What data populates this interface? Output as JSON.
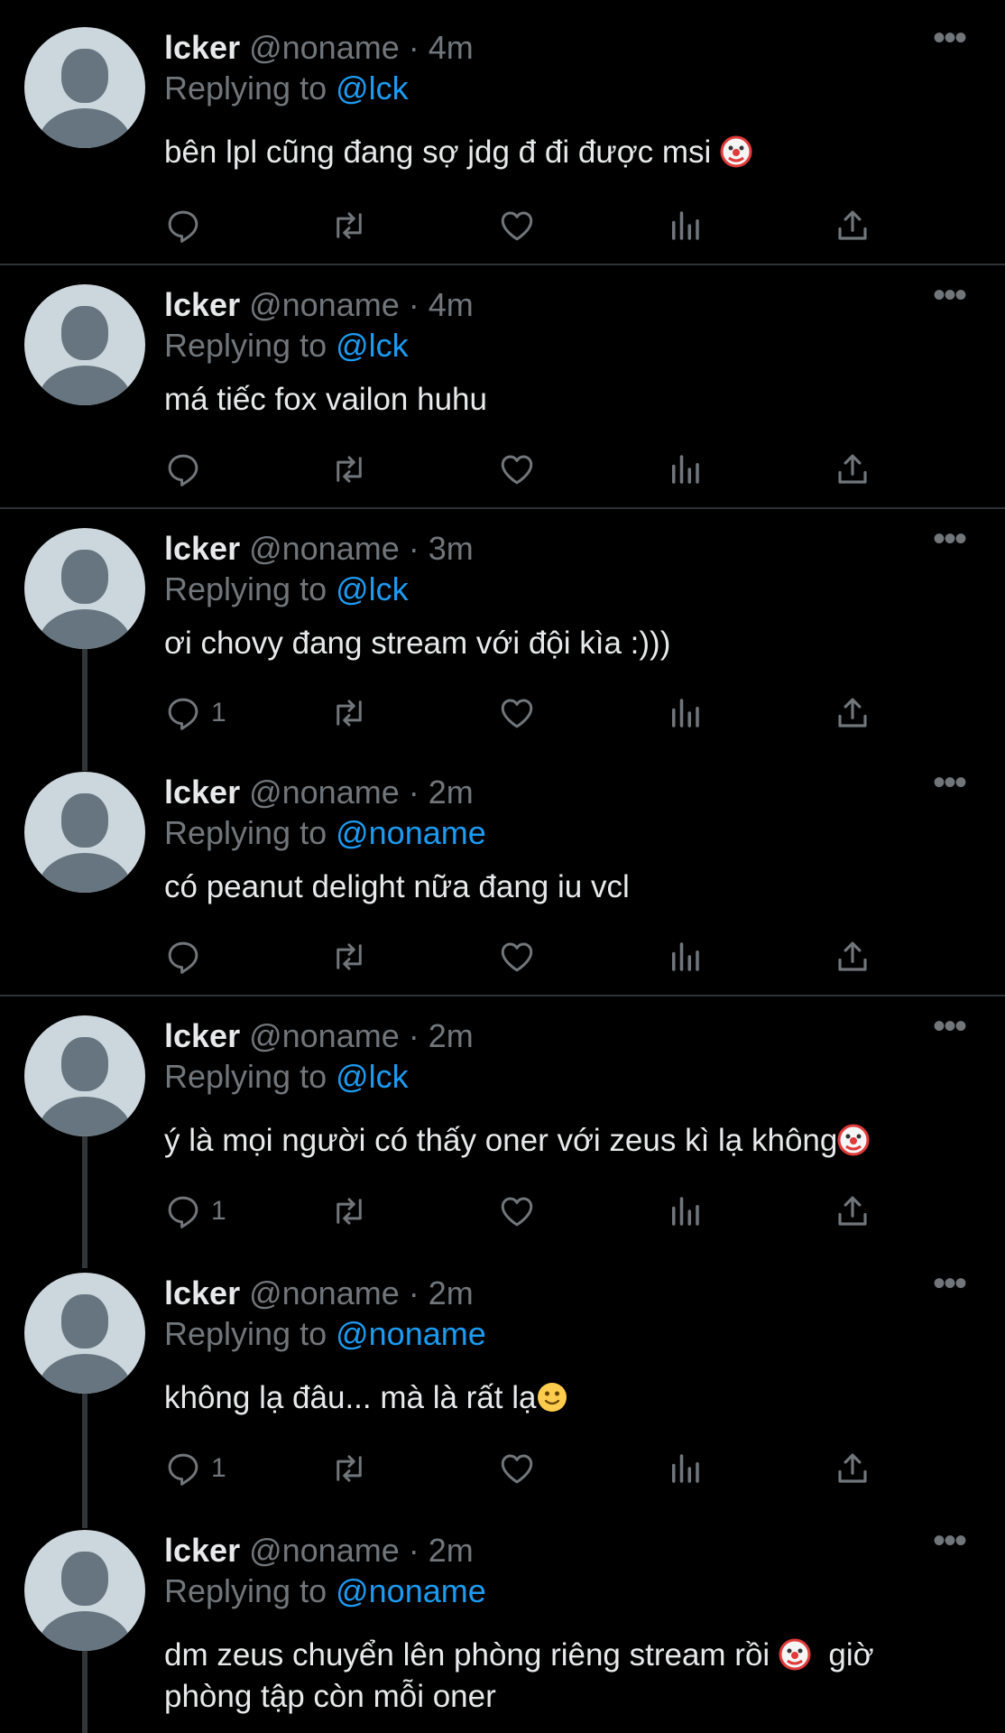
{
  "tweets": [
    {
      "name": "lcker",
      "handle": "@noname",
      "dot": "·",
      "time": "4m",
      "replying_prefix": "Replying to ",
      "reply_to": "@lck",
      "text": "bên lpl cũng đang sợ jdg đ đi được msi",
      "emoji": "clown-face",
      "reply_count": ""
    },
    {
      "name": "lcker",
      "handle": "@noname",
      "dot": "·",
      "time": "4m",
      "replying_prefix": "Replying to ",
      "reply_to": "@lck",
      "text": "má tiếc fox vailon huhu",
      "emoji": "",
      "reply_count": ""
    },
    {
      "name": "lcker",
      "handle": "@noname",
      "dot": "·",
      "time": "3m",
      "replying_prefix": "Replying to ",
      "reply_to": "@lck",
      "text": "ơi chovy đang stream với đội kìa :)))",
      "emoji": "",
      "reply_count": "1"
    },
    {
      "name": "lcker",
      "handle": "@noname",
      "dot": "·",
      "time": "2m",
      "replying_prefix": "Replying to ",
      "reply_to": "@noname",
      "text": "có peanut delight nữa đang iu vcl",
      "emoji": "",
      "reply_count": ""
    },
    {
      "name": "lcker",
      "handle": "@noname",
      "dot": "·",
      "time": "2m",
      "replying_prefix": "Replying to ",
      "reply_to": "@lck",
      "text": "ý là mọi người có thấy oner với zeus kì lạ không",
      "emoji": "clown-face",
      "reply_count": "1"
    },
    {
      "name": "lcker",
      "handle": "@noname",
      "dot": "·",
      "time": "2m",
      "replying_prefix": "Replying to ",
      "reply_to": "@noname",
      "text": "không lạ đâu... mà là rất lạ",
      "emoji": "slightly-smiling-face",
      "reply_count": "1"
    },
    {
      "name": "lcker",
      "handle": "@noname",
      "dot": "·",
      "time": "2m",
      "replying_prefix": "Replying to ",
      "reply_to": "@noname",
      "text": "dm zeus chuyển lên phòng riêng stream rồi",
      "emoji": "clown-face",
      "text_after": "giờ phòng tập còn mỗi oner",
      "reply_count": ""
    }
  ],
  "icons": {
    "reply": "reply-icon",
    "retweet": "retweet-icon",
    "like": "heart-icon",
    "views": "analytics-icon",
    "share": "share-icon",
    "more": "more-icon"
  },
  "colors": {
    "background": "#000000",
    "text": "#e7e9ea",
    "secondary": "#71767b",
    "link": "#1d9bf0",
    "divider": "#2f3336"
  }
}
